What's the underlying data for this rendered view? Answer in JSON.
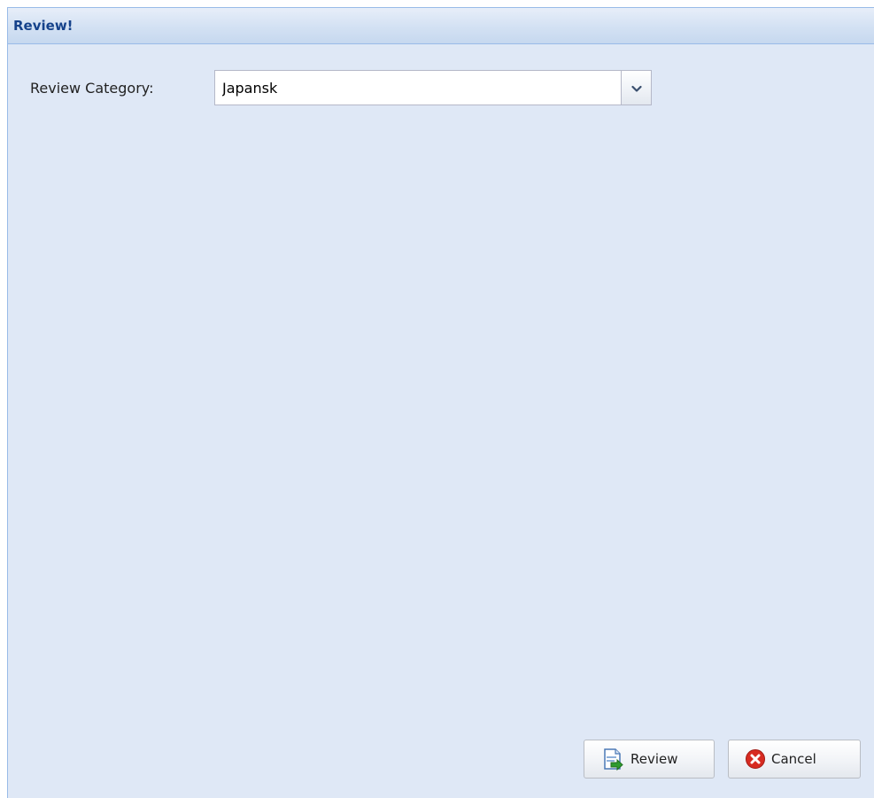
{
  "window": {
    "title": "Review!"
  },
  "form": {
    "category_label": "Review Category:",
    "category_value": "Japansk"
  },
  "buttons": {
    "review_label": "Review",
    "cancel_label": "Cancel"
  },
  "icons": {
    "combo_trigger": "chevron-down-icon",
    "review": "document-arrow-icon",
    "cancel": "cancel-circle-icon"
  },
  "colors": {
    "panel_background": "#dfe8f6",
    "title_text": "#15428b",
    "border": "#99bbe8",
    "cancel_icon": "#d72b21",
    "review_icon_arrow": "#2e9b2e"
  }
}
